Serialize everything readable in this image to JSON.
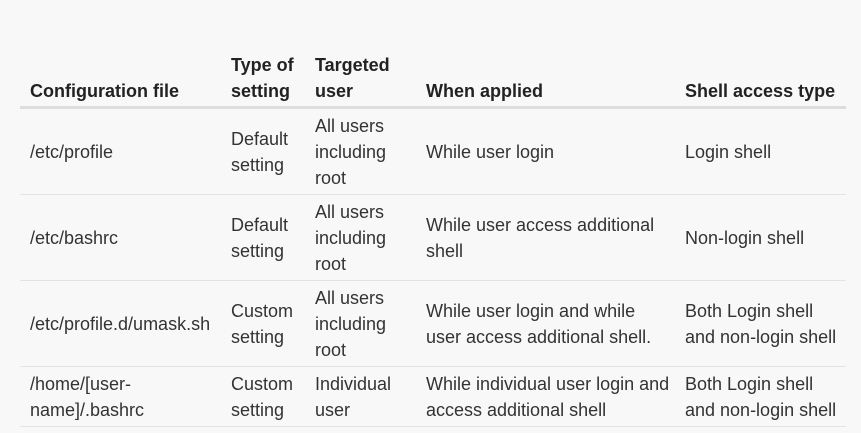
{
  "table": {
    "headers": [
      "Configuration file",
      "Type of setting",
      "Targeted user",
      "When applied",
      "Shell access type"
    ],
    "rows": [
      [
        "/etc/profile",
        "Default setting",
        "All users including root",
        "While user login",
        "Login shell"
      ],
      [
        "/etc/bashrc",
        "Default setting",
        "All users including root",
        "While user access additional shell",
        "Non-login shell"
      ],
      [
        "/etc/profile.d/umask.sh",
        "Custom setting",
        "All users including root",
        "While user login and while user access additional shell.",
        "Both Login shell and non-login shell"
      ],
      [
        "/home/[user-name]/.bashrc",
        "Custom setting",
        "Individual user",
        "While individual user login and access additional shell",
        "Both Login shell and non-login shell"
      ]
    ]
  }
}
